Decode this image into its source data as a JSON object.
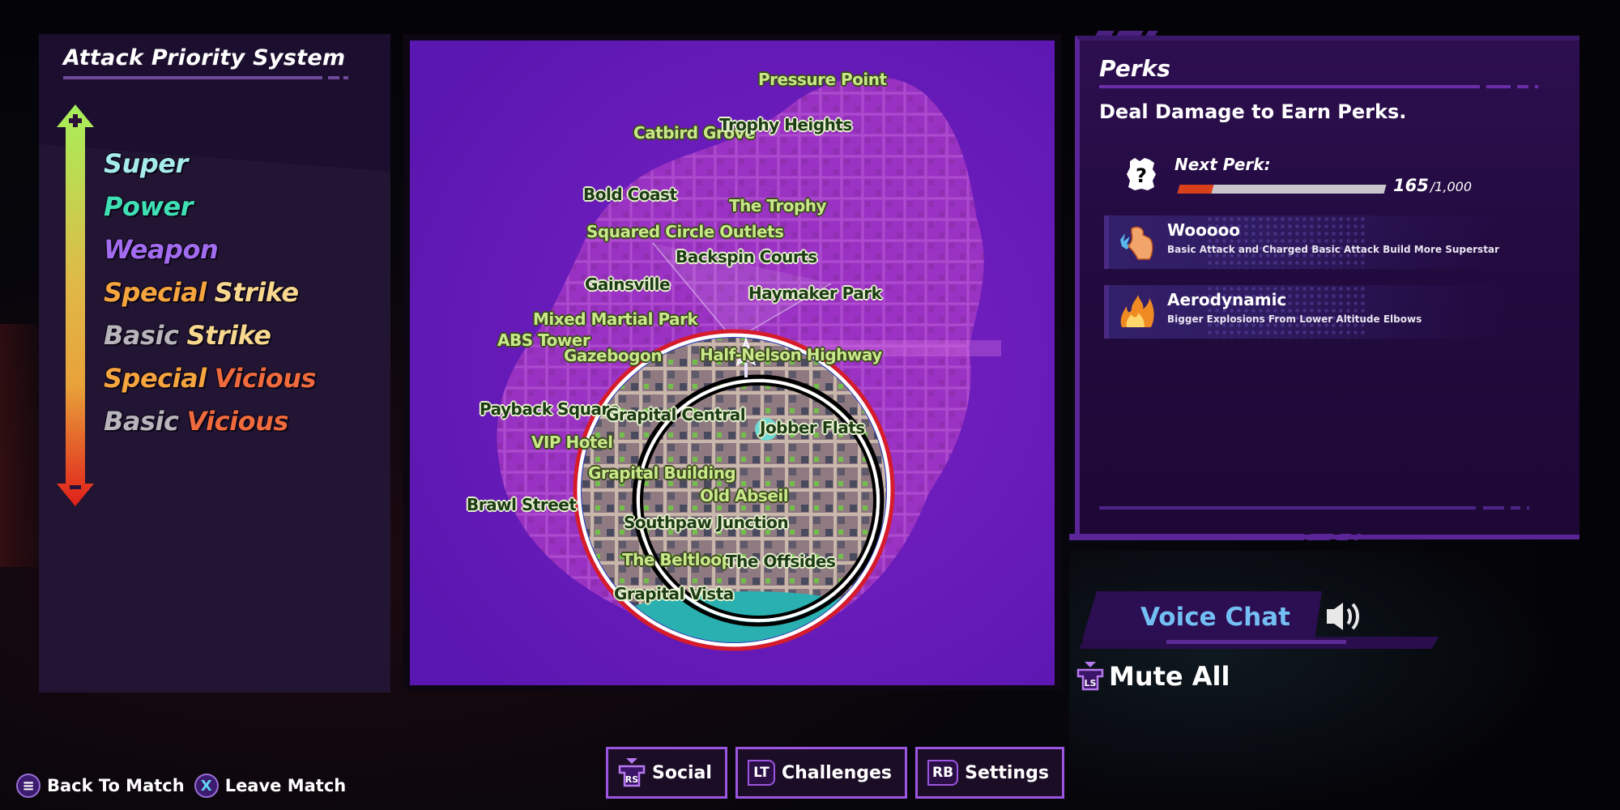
{
  "attack_priority": {
    "title": "Attack Priority System",
    "items": [
      {
        "parts": [
          {
            "text": "Super",
            "color": "#a7ecec"
          }
        ]
      },
      {
        "parts": [
          {
            "text": "Power",
            "color": "#3fe0b4"
          }
        ]
      },
      {
        "parts": [
          {
            "text": "Weapon",
            "color": "#a36cf0"
          }
        ]
      },
      {
        "parts": [
          {
            "text": "Special",
            "color": "#f5a43e"
          },
          {
            "text": "Strike",
            "color": "#f8d88e"
          }
        ]
      },
      {
        "parts": [
          {
            "text": "Basic",
            "color": "#b7b5bb"
          },
          {
            "text": "Strike",
            "color": "#f8d88e"
          }
        ]
      },
      {
        "parts": [
          {
            "text": "Special",
            "color": "#f5a43e"
          },
          {
            "text": "Vicious",
            "color": "#ef6a3c"
          }
        ]
      },
      {
        "parts": [
          {
            "text": "Basic",
            "color": "#b7b5bb"
          },
          {
            "text": "Vicious",
            "color": "#ef6a3c"
          }
        ]
      }
    ],
    "arrow_top_symbol": "+",
    "arrow_bottom_symbol": "-",
    "arrow_colors": {
      "top": "#a6f05a",
      "middle": "#e8a23a",
      "bottom": "#e0201a"
    }
  },
  "map": {
    "labels_minor": [
      "Pressure Point",
      "Catbird Grove",
      "The Trophy",
      "Squared Circle Outlets",
      "Mixed Martial Park",
      "ABS Tower",
      "Gazebogon",
      "Half-Nelson Highway",
      "VIP Hotel",
      "Grapital Building",
      "Old Abseil",
      "The Beltloop"
    ],
    "labels_major": [
      "Trophy Heights",
      "Bold Coast",
      "Backspin Courts",
      "Gainsville",
      "Haymaker Park",
      "Payback Square",
      "Grapital Central",
      "Jobber Flats",
      "Brawl Street",
      "Southpaw Junction",
      "The Offsides",
      "Grapital Vista"
    ],
    "player_marker": "player-arrow",
    "storm_ring_colors": [
      "#d61c2a",
      "#ffffff",
      "#2336b8"
    ]
  },
  "perks": {
    "title": "Perks",
    "subtitle": "Deal Damage to Earn Perks.",
    "next_perk_label": "Next Perk:",
    "progress_current": "165",
    "progress_max": "/1,000",
    "progress_fraction": 0.165,
    "owned": [
      {
        "name": "Wooooo",
        "description": "Basic Attack and Charged Basic Attack Build More Superstar",
        "icon": "elbow-spark-icon"
      },
      {
        "name": "Aerodynamic",
        "description": "Bigger Explosions From Lower Altitude Elbows",
        "icon": "flame-elbow-icon"
      }
    ]
  },
  "voice_chat": {
    "title": "Voice Chat",
    "mute_all_glyph": "LS",
    "mute_all_label": "Mute All"
  },
  "bottom_bar": {
    "back_glyph": "≡",
    "back_label": "Back To Match",
    "leave_glyph": "X",
    "leave_label": "Leave Match",
    "tabs": [
      {
        "glyph": "RS",
        "label": "Social"
      },
      {
        "glyph": "LT",
        "label": "Challenges"
      },
      {
        "glyph": "RB",
        "label": "Settings"
      }
    ]
  }
}
